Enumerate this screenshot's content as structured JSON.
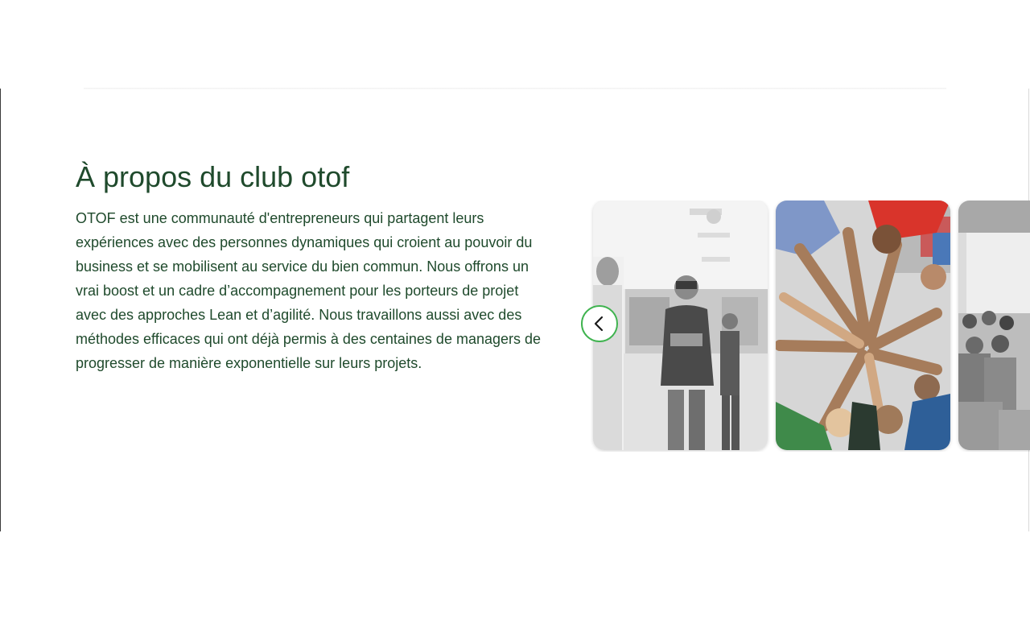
{
  "about": {
    "title": "À propos du club otof",
    "text": "OTOF est une communauté d'entrepreneurs qui partagent leurs expériences avec des personnes dynamiques qui croient au pouvoir du business et se mobilisent au service du bien commun. Nous offrons un vrai boost et un cadre d’accompagnement pour les porteurs de projet avec des approches Lean et d’agilité. Nous travaillons aussi avec des méthodes efficaces qui ont déjà permis à des centaines de managers de progresser de manière exponentielle sur leurs projets."
  },
  "carousel": {
    "prev_icon": "chevron-left-icon",
    "slides": [
      {
        "name": "team-office-photo",
        "style": "grayscale"
      },
      {
        "name": "hands-together-photo",
        "style": "partial-color"
      },
      {
        "name": "conference-audience-photo",
        "style": "grayscale"
      }
    ]
  },
  "colors": {
    "text_green": "#1f4a2c",
    "accent_green": "#3fb34f",
    "background": "#ffffff"
  }
}
